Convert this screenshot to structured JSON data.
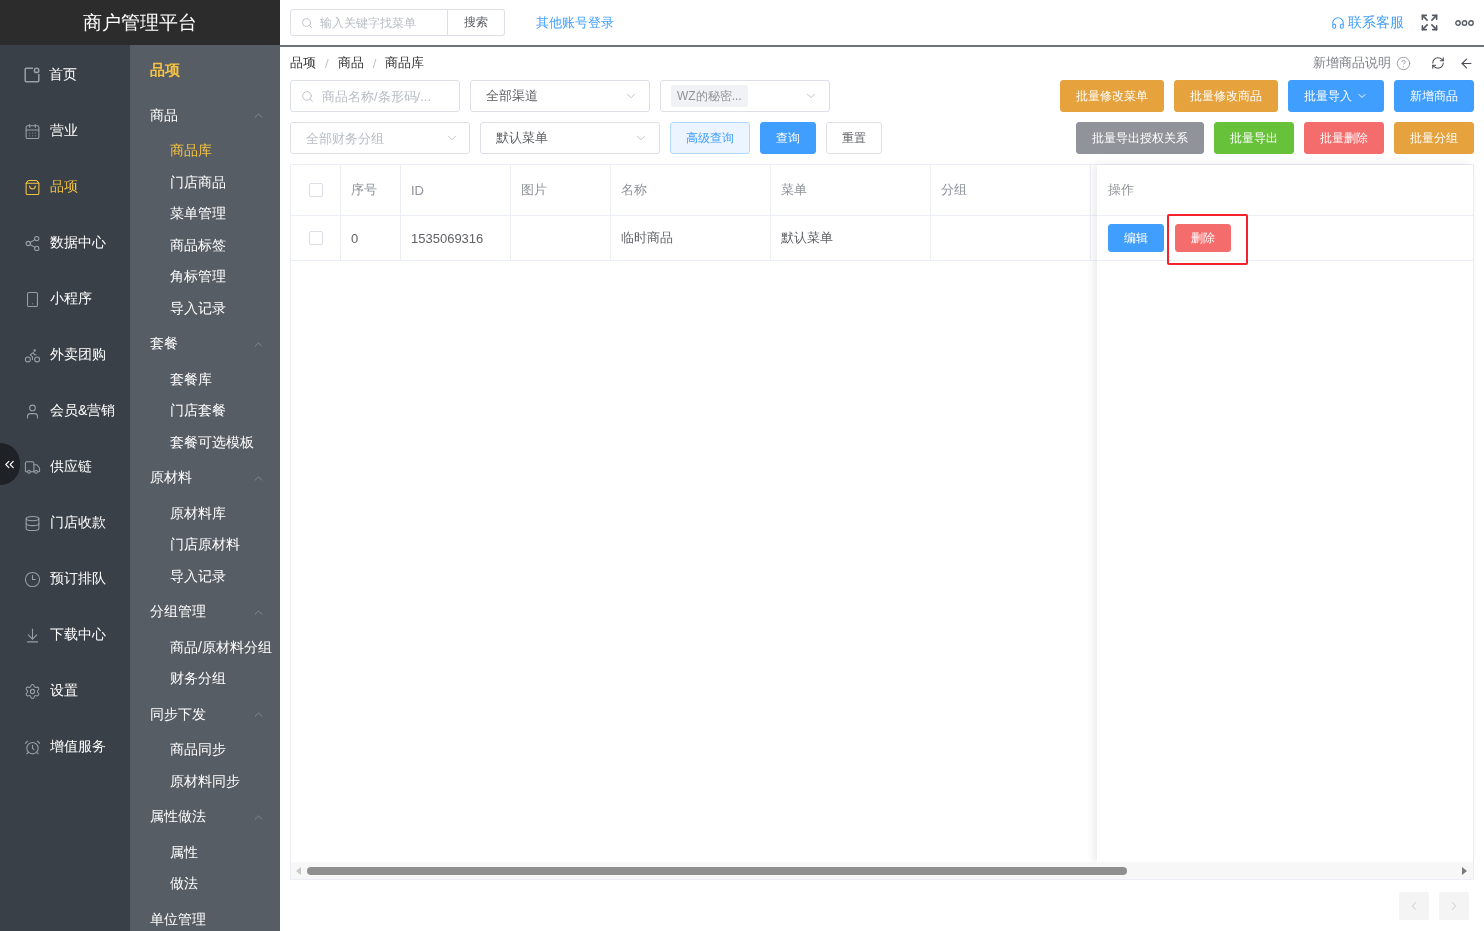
{
  "brand": {
    "title": "商户管理平台"
  },
  "main_nav": {
    "items": [
      {
        "label": "首页",
        "selected": false
      },
      {
        "label": "营业",
        "selected": false
      },
      {
        "label": "品项",
        "selected": true
      },
      {
        "label": "数据中心",
        "selected": false
      },
      {
        "label": "小程序",
        "selected": false
      },
      {
        "label": "外卖团购",
        "selected": false
      },
      {
        "label": "会员&营销",
        "selected": false
      },
      {
        "label": "供应链",
        "selected": false
      },
      {
        "label": "门店收款",
        "selected": false
      },
      {
        "label": "预订排队",
        "selected": false
      },
      {
        "label": "下载中心",
        "selected": false
      },
      {
        "label": "设置",
        "selected": false
      },
      {
        "label": "增值服务",
        "selected": false
      }
    ]
  },
  "sub_nav": {
    "title": "品项",
    "groups": [
      {
        "label": "商品",
        "expanded": true,
        "children": [
          {
            "label": "商品库",
            "selected": true
          },
          {
            "label": "门店商品",
            "selected": false
          },
          {
            "label": "菜单管理",
            "selected": false
          },
          {
            "label": "商品标签",
            "selected": false
          },
          {
            "label": "角标管理",
            "selected": false
          },
          {
            "label": "导入记录",
            "selected": false
          }
        ]
      },
      {
        "label": "套餐",
        "expanded": true,
        "children": [
          {
            "label": "套餐库",
            "selected": false
          },
          {
            "label": "门店套餐",
            "selected": false
          },
          {
            "label": "套餐可选模板",
            "selected": false
          }
        ]
      },
      {
        "label": "原材料",
        "expanded": true,
        "children": [
          {
            "label": "原材料库",
            "selected": false
          },
          {
            "label": "门店原材料",
            "selected": false
          },
          {
            "label": "导入记录",
            "selected": false
          }
        ]
      },
      {
        "label": "分组管理",
        "expanded": true,
        "children": [
          {
            "label": "商品/原材料分组",
            "selected": false
          },
          {
            "label": "财务分组",
            "selected": false
          }
        ]
      },
      {
        "label": "同步下发",
        "expanded": true,
        "children": [
          {
            "label": "商品同步",
            "selected": false
          },
          {
            "label": "原材料同步",
            "selected": false
          }
        ]
      },
      {
        "label": "属性做法",
        "expanded": true,
        "children": [
          {
            "label": "属性",
            "selected": false
          },
          {
            "label": "做法",
            "selected": false
          }
        ]
      },
      {
        "label": "单位管理"
      }
    ]
  },
  "topbar": {
    "search": {
      "placeholder": "输入关键字找菜单",
      "button": "搜索"
    },
    "account_link": "其他账号登录",
    "support_link": "联系客服"
  },
  "page_header": {
    "breadcrumb": [
      {
        "label": "品项",
        "separator": "/"
      },
      {
        "label": "商品",
        "separator": "/"
      },
      {
        "label": "商品库"
      }
    ],
    "help": "新增商品说明"
  },
  "filters": {
    "keyword": {
      "placeholder": "商品名称/条形码/..."
    },
    "channel": {
      "value": "全部渠道"
    },
    "store": {
      "tag": "WZ的秘密..."
    },
    "finance_group": {
      "placeholder": "全部财务分组"
    },
    "menu": {
      "value": "默认菜单"
    },
    "buttons": [
      {
        "label": "高级查询",
        "kind": "plain"
      },
      {
        "label": "查询",
        "kind": "primary"
      },
      {
        "label": "重置",
        "kind": "default"
      }
    ]
  },
  "actions": {
    "row_1": [
      {
        "label": "批量修改菜单",
        "kind": "warning",
        "dropdown": false
      },
      {
        "label": "批量修改商品",
        "kind": "warning",
        "dropdown": false
      },
      {
        "label": "批量导入",
        "kind": "primary",
        "dropdown": true
      },
      {
        "label": "新增商品",
        "kind": "primary",
        "dropdown": false
      }
    ],
    "row_2": [
      {
        "label": "批量导出授权关系",
        "kind": "info",
        "dropdown": false
      },
      {
        "label": "批量导出",
        "kind": "success",
        "dropdown": false
      },
      {
        "label": "批量删除",
        "kind": "danger",
        "dropdown": false
      },
      {
        "label": "批量分组",
        "kind": "warning",
        "dropdown": false
      }
    ]
  },
  "table": {
    "header_checked": false,
    "columns": [
      "序号",
      "ID",
      "图片",
      "名称",
      "菜单",
      "分组",
      "操作"
    ],
    "rows": [
      {
        "checked": false,
        "index": "0",
        "id": "1535069316",
        "name": "临时商品",
        "menu": "默认菜单",
        "actions": [
          {
            "label": "编辑",
            "kind": "primary",
            "highlighted": false
          },
          {
            "label": "删除",
            "kind": "danger",
            "highlighted": true
          }
        ]
      }
    ]
  },
  "pagination": {
    "prev": {
      "disabled": true
    },
    "next": {
      "disabled": true
    }
  }
}
